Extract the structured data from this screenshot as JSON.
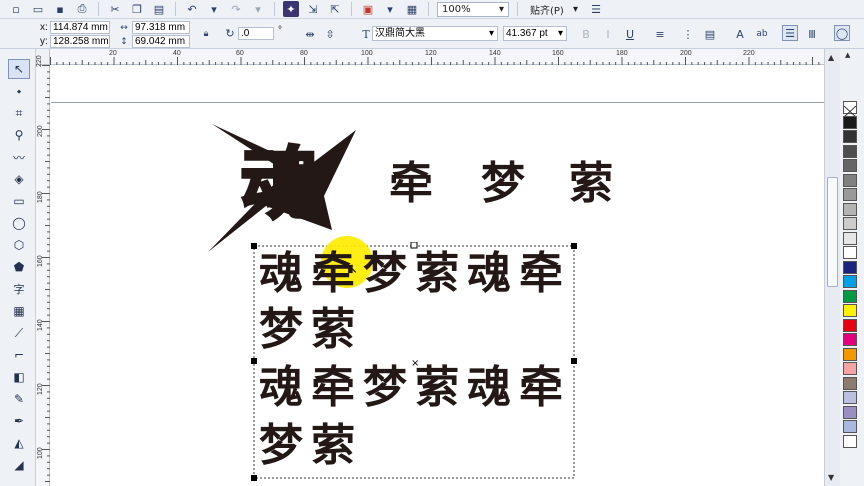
{
  "toolbar": {
    "zoom": "100%",
    "snap_label": "贴齐(P)"
  },
  "propbar": {
    "x_label": "x:",
    "x_value": "114.874 mm",
    "y_label": "y:",
    "y_value": "128.258 mm",
    "width_value": "97.318 mm",
    "height_value": "69.042 mm",
    "rotation_value": ".0",
    "degree_symbol": "°",
    "font_name": "汉鼎简大黑",
    "font_size": "41.367 pt"
  },
  "rulers": {
    "horizontal": [
      "20",
      "40",
      "60",
      "80",
      "100",
      "120",
      "140",
      "160",
      "180",
      "200",
      "220"
    ],
    "vertical": [
      "220",
      "200",
      "180",
      "160",
      "140",
      "120",
      "100"
    ]
  },
  "canvas": {
    "logo_char": "魂",
    "title_chars": [
      "牵",
      "梦",
      "萦"
    ],
    "text_line1": [
      "魂",
      "牵",
      "梦",
      "萦",
      "魂",
      "牵"
    ],
    "text_line2": [
      "梦",
      "萦"
    ],
    "text_line3": [
      "魂",
      "牵",
      "梦",
      "萦",
      "魂",
      "牵"
    ],
    "text_line4": [
      "梦",
      "萦"
    ]
  },
  "colors": {
    "text": "#231815",
    "cursor_highlight": "#ffec00",
    "palette": [
      "#ffffff",
      "#1a1a1a",
      "#333333",
      "#4d4d4d",
      "#666666",
      "#808080",
      "#999999",
      "#b3b3b3",
      "#cccccc",
      "#e6e6e6",
      "#ffffff",
      "#1a237e",
      "#00a0e9",
      "#009944",
      "#fff100",
      "#e60012",
      "#e4007f",
      "#f39800",
      "#f5a3a3",
      "#8c7b6e",
      "#bdbfe0",
      "#9a8fc4",
      "#a9b8de",
      "#ffffff"
    ]
  }
}
